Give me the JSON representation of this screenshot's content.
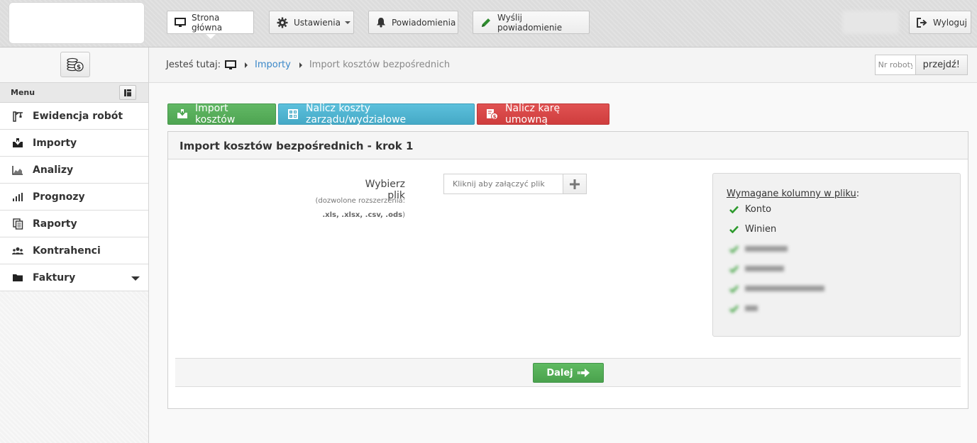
{
  "topbar": {
    "home": "Strona główna",
    "settings": "Ustawienia",
    "notifications": "Powiadomienia",
    "send_notification": "Wyślij powiadomienie",
    "logout": "Wyloguj"
  },
  "sidebar": {
    "menu_label": "Menu",
    "items": [
      {
        "label": "Ewidencja robót",
        "icon": "crane-icon"
      },
      {
        "label": "Importy",
        "icon": "import-icon"
      },
      {
        "label": "Analizy",
        "icon": "area-chart-icon"
      },
      {
        "label": "Prognozy",
        "icon": "bar-chart-icon"
      },
      {
        "label": "Raporty",
        "icon": "reports-icon"
      },
      {
        "label": "Kontrahenci",
        "icon": "users-icon"
      },
      {
        "label": "Faktury",
        "icon": "folder-icon"
      }
    ]
  },
  "breadcrumb": {
    "prefix": "Jesteś tutaj:",
    "link": "Importy",
    "current": "Import kosztów bezpośrednich"
  },
  "goto": {
    "placeholder": "Nr roboty",
    "button": "przejdź!"
  },
  "actions": {
    "import_costs": "Import kosztów",
    "calc_overhead": "Nalicz koszty zarządu/wydziałowe",
    "calc_penalty": "Nalicz karę umowną"
  },
  "panel": {
    "title": "Import kosztów bezpośrednich - krok 1",
    "choose_file": "Wybierz plik",
    "allowed_ext_label": "(dozwolone rozszerzenia:",
    "allowed_ext": ".xls, .xlsx, .csv, .ods",
    "allowed_ext_close": ")",
    "file_placeholder": "Kliknij aby załączyć plik",
    "required_title": "Wymagane kolumny w pliku",
    "required_colon": ":",
    "required_columns": [
      "Konto",
      "Winien"
    ],
    "next_button": "Dalej"
  },
  "colors": {
    "accent_link": "#3a87c8",
    "btn_green": "#4ea451",
    "btn_blue": "#45a9c6",
    "btn_red": "#cf3d3d",
    "check_green": "#2d9a2d"
  }
}
